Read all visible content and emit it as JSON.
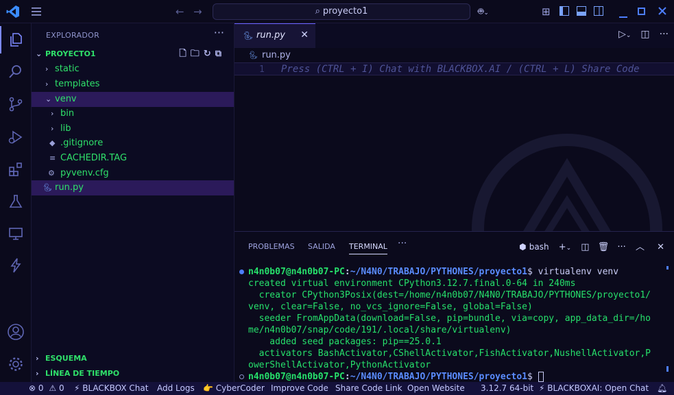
{
  "titlebar": {
    "search_text": "proyecto1",
    "icons": [
      "vscode-logo-icon",
      "hamburger-menu-icon",
      "back-arrow-icon",
      "forward-arrow-icon",
      "copilot-icon",
      "layout-icon",
      "toggle-sidebar-icon",
      "toggle-panel-icon",
      "toggle-secondary-sidebar-icon",
      "minimize-icon",
      "maximize-icon",
      "close-icon"
    ]
  },
  "activity_bar": {
    "items": [
      "explorer-icon",
      "search-icon",
      "source-control-icon",
      "run-debug-icon",
      "extensions-icon",
      "testing-icon",
      "remote-explorer-icon",
      "blackbox-icon",
      "accounts-icon",
      "manage-gear-icon"
    ]
  },
  "explorer": {
    "title": "EXPLORADOR",
    "project": "PROYECTO1",
    "items": [
      {
        "label": "static",
        "type": "folder"
      },
      {
        "label": "templates",
        "type": "folder"
      },
      {
        "label": "venv",
        "type": "folder-open"
      },
      {
        "label": "bin",
        "type": "folder"
      },
      {
        "label": "lib",
        "type": "folder"
      },
      {
        "label": ".gitignore",
        "type": "file"
      },
      {
        "label": "CACHEDIR.TAG",
        "type": "file"
      },
      {
        "label": "pyvenv.cfg",
        "type": "file"
      },
      {
        "label": "run.py",
        "type": "python"
      }
    ],
    "sections": [
      "ESQUEMA",
      "LÍNEA DE TIEMPO"
    ]
  },
  "editor": {
    "tab_label": "run.py",
    "breadcrumb": "run.py",
    "line_number": "1",
    "hint": "Press (CTRL + I) Chat with BLACKBOX.AI / (CTRL + L) Share Code"
  },
  "panel": {
    "tabs": [
      "PROBLEMAS",
      "SALIDA",
      "TERMINAL"
    ],
    "active_tab": "TERMINAL",
    "shell": "bash",
    "terminal": {
      "prompt_user": "n4n0b07@n4n0b07-PC",
      "prompt_path": "~/N4N0/TRABAJO/PYTHONES/proyecto1",
      "command": "virtualenv venv",
      "output": [
        "created virtual environment CPython3.12.7.final.0-64 in 240ms",
        "  creator CPython3Posix(dest=/home/n4n0b07/N4N0/TRABAJO/PYTHONES/proyecto1/",
        "venv, clear=False, no_vcs_ignore=False, global=False)",
        "  seeder FromAppData(download=False, pip=bundle, via=copy, app_data_dir=/ho",
        "me/n4n0b07/snap/code/191/.local/share/virtualenv)",
        "    added seed packages: pip==25.0.1",
        "  activators BashActivator,CShellActivator,FishActivator,NushellActivator,P",
        "owerShellActivator,PythonActivator"
      ]
    }
  },
  "statusbar": {
    "problems": "0",
    "warnings": "0",
    "items": [
      "⚡ BLACKBOX Chat",
      "Add Logs",
      "👉 CyberCoder",
      "Improve Code",
      "Share Code Link",
      "Open Website",
      "3.12.7 64-bit",
      "⚡ BLACKBOXAI: Open Chat"
    ]
  },
  "colors": {
    "accent": "#7d89ff",
    "tree_text": "#2fe06a",
    "selection": "#3f2a78",
    "statusbar_bg": "#14113a"
  }
}
